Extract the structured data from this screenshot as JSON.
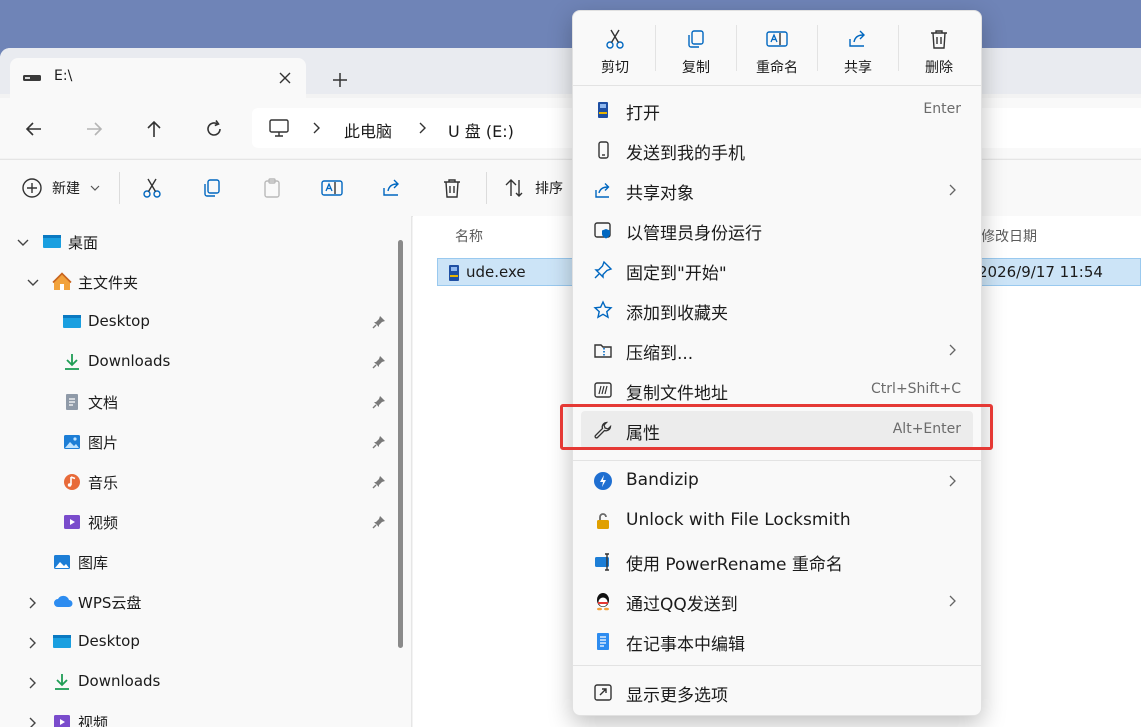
{
  "tab": {
    "title": "E:\\"
  },
  "address": {
    "crumbs": [
      "此电脑",
      "U 盘 (E:)"
    ]
  },
  "toolbar": {
    "new_label": "新建",
    "sort_label": "排序"
  },
  "sidebar": {
    "items": [
      {
        "label": "桌面",
        "icon": "desktop-icon",
        "expander": "expanded",
        "pinned": false
      },
      {
        "label": "主文件夹",
        "icon": "home-icon",
        "expander": "expanded",
        "pinned": false
      },
      {
        "label": "Desktop",
        "icon": "desktop-icon",
        "expander": "none",
        "pinned": true
      },
      {
        "label": "Downloads",
        "icon": "download-icon",
        "expander": "none",
        "pinned": true
      },
      {
        "label": "文档",
        "icon": "document-icon",
        "expander": "none",
        "pinned": true
      },
      {
        "label": "图片",
        "icon": "pictures-icon",
        "expander": "none",
        "pinned": true
      },
      {
        "label": "音乐",
        "icon": "music-icon",
        "expander": "none",
        "pinned": true
      },
      {
        "label": "视频",
        "icon": "video-icon",
        "expander": "none",
        "pinned": true
      },
      {
        "label": "图库",
        "icon": "gallery-icon",
        "expander": "none",
        "pinned": false
      },
      {
        "label": "WPS云盘",
        "icon": "cloud-icon",
        "expander": "collapsed",
        "pinned": false
      },
      {
        "label": "Desktop",
        "icon": "desktop-icon",
        "expander": "collapsed",
        "pinned": false
      },
      {
        "label": "Downloads",
        "icon": "download-icon",
        "expander": "collapsed",
        "pinned": false
      },
      {
        "label": "视频",
        "icon": "video-icon",
        "expander": "collapsed",
        "pinned": false
      }
    ]
  },
  "content": {
    "columns": {
      "name": "名称",
      "date": "修改日期"
    },
    "files": [
      {
        "name": "ude.exe",
        "modified": "2026/9/17 11:54"
      }
    ]
  },
  "context_menu": {
    "quick_actions": [
      {
        "label": "剪切",
        "icon": "cut-icon"
      },
      {
        "label": "复制",
        "icon": "copy-icon"
      },
      {
        "label": "重命名",
        "icon": "rename-icon"
      },
      {
        "label": "共享",
        "icon": "share-icon"
      },
      {
        "label": "删除",
        "icon": "delete-icon"
      }
    ],
    "items": [
      {
        "label": "打开",
        "shortcut": "Enter",
        "icon": "open-exe-icon"
      },
      {
        "label": "发送到我的手机",
        "icon": "phone-icon"
      },
      {
        "label": "共享对象",
        "icon": "share-icon",
        "submenu": true
      },
      {
        "label": "以管理员身份运行",
        "icon": "shield-icon"
      },
      {
        "label": "固定到\"开始\"",
        "icon": "pin-icon"
      },
      {
        "label": "添加到收藏夹",
        "icon": "star-icon"
      },
      {
        "label": "压缩到...",
        "icon": "zip-folder-icon",
        "submenu": true
      },
      {
        "label": "复制文件地址",
        "shortcut": "Ctrl+Shift+C",
        "icon": "copy-path-icon"
      },
      {
        "label": "属性",
        "shortcut": "Alt+Enter",
        "icon": "wrench-icon",
        "highlighted": true
      },
      {
        "label": "Bandizip",
        "icon": "bandizip-icon",
        "submenu": true
      },
      {
        "label": "Unlock with File Locksmith",
        "icon": "lock-icon"
      },
      {
        "label": "使用 PowerRename 重命名",
        "icon": "powerrename-icon"
      },
      {
        "label": "通过QQ发送到",
        "icon": "qq-icon",
        "submenu": true
      },
      {
        "label": "在记事本中编辑",
        "icon": "notepad-icon"
      },
      {
        "label": "显示更多选项",
        "icon": "more-options-icon"
      }
    ]
  },
  "colors": {
    "accent": "#0067c0",
    "highlight_box": "#e53935",
    "selection": "#cce4f7"
  }
}
